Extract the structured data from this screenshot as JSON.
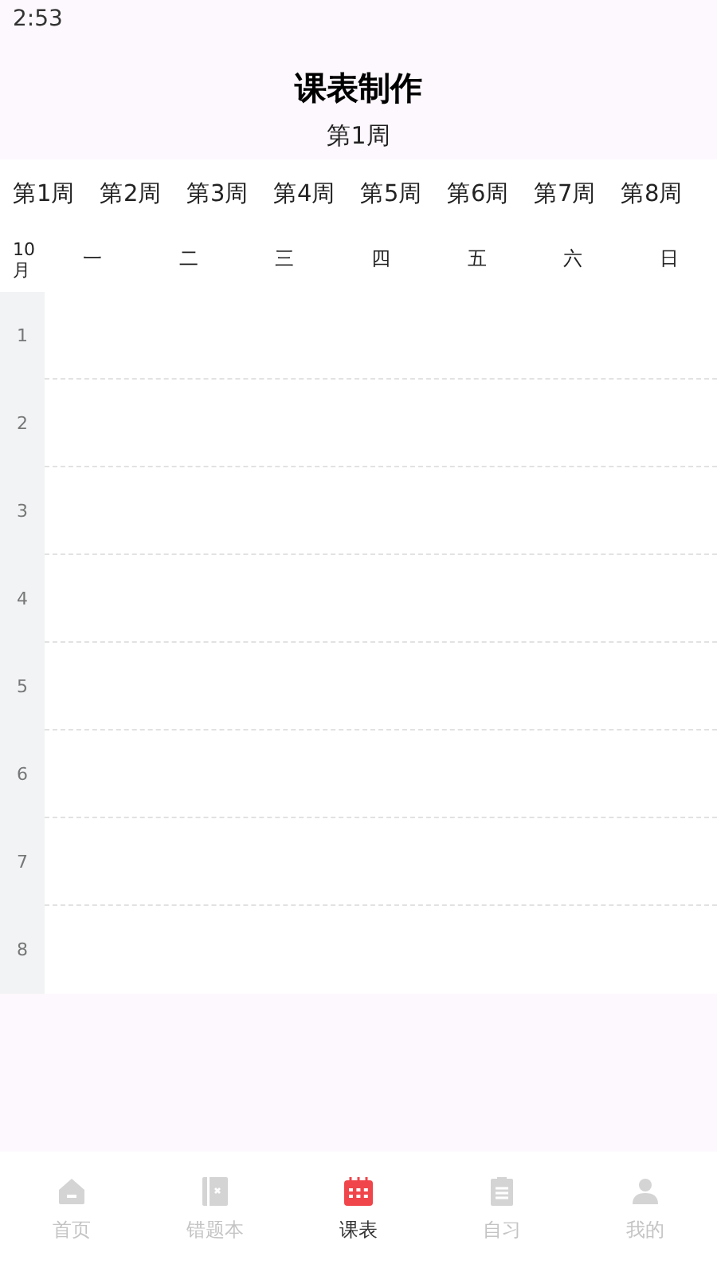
{
  "status_bar": {
    "time": "2:53"
  },
  "header": {
    "title": "课表制作",
    "subtitle": "第1周"
  },
  "weeks": [
    "第1周",
    "第2周",
    "第3周",
    "第4周",
    "第5周",
    "第6周",
    "第7周",
    "第8周"
  ],
  "timetable": {
    "month": "10\n月",
    "days": [
      "一",
      "二",
      "三",
      "四",
      "五",
      "六",
      "日"
    ],
    "periods": [
      "1",
      "2",
      "3",
      "4",
      "5",
      "6",
      "7",
      "8"
    ]
  },
  "bottom_nav": [
    {
      "label": "首页",
      "kind": "home",
      "selected": false
    },
    {
      "label": "错题本",
      "kind": "book",
      "selected": false
    },
    {
      "label": "课表",
      "kind": "calendar",
      "selected": true
    },
    {
      "label": "自习",
      "kind": "clipboard",
      "selected": false
    },
    {
      "label": "我的",
      "kind": "person",
      "selected": false
    }
  ]
}
